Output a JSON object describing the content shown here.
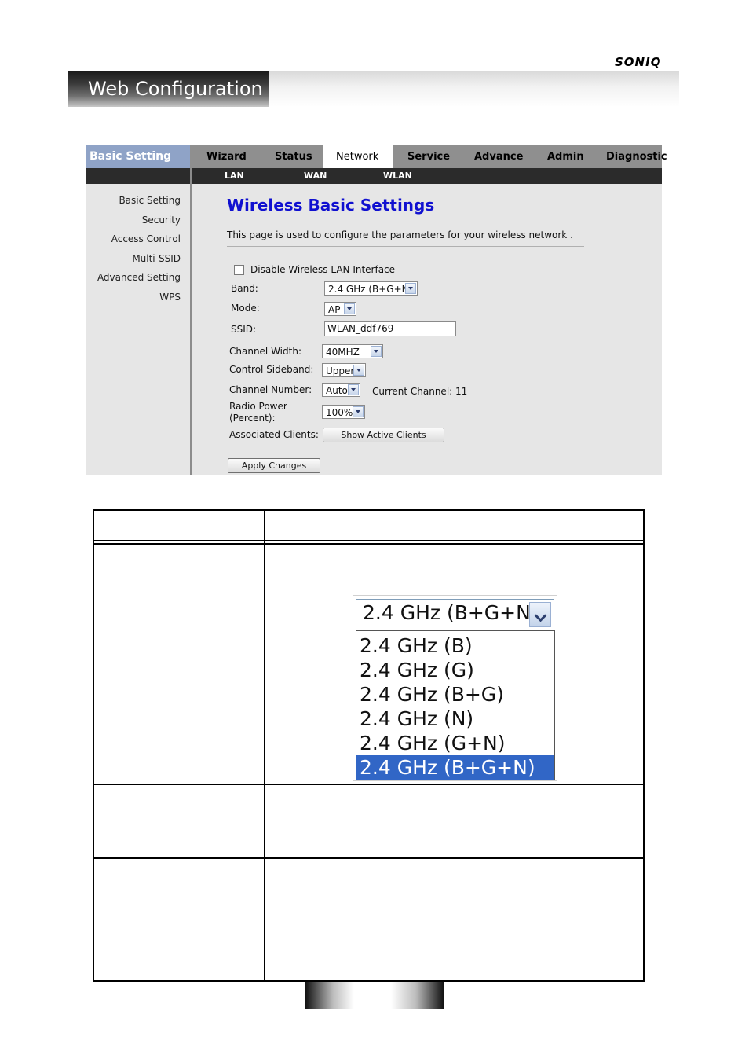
{
  "brand": "SONIQ",
  "banner": {
    "title": "Web Configuration"
  },
  "nav": {
    "items": [
      "Basic Setting",
      "Wizard",
      "Status",
      "Network",
      "Service",
      "Advance",
      "Admin",
      "Diagnostic"
    ],
    "active": "Network",
    "subitems": [
      "LAN",
      "WAN",
      "WLAN"
    ]
  },
  "sidebar": {
    "items": [
      "Basic Setting",
      "Security",
      "Access Control",
      "Multi-SSID",
      "Advanced Setting",
      "WPS"
    ]
  },
  "main": {
    "title": "Wireless Basic Settings",
    "description": "This page is used to configure the parameters for your wireless network .",
    "disable_label": "Disable Wireless LAN Interface",
    "band_label": "Band:",
    "band_value": "2.4 GHz (B+G+N)",
    "mode_label": "Mode:",
    "mode_value": "AP",
    "ssid_label": "SSID:",
    "ssid_value": "WLAN_ddf769",
    "cw_label": "Channel Width:",
    "cw_value": "40MHZ",
    "cs_label": "Control Sideband:",
    "cs_value": "Upper",
    "cn_label": "Channel Number:",
    "cn_value": "Auto",
    "current_channel_label": "Current Channel:",
    "current_channel_value": "11",
    "rp_label_1": "Radio Power",
    "rp_label_2": "(Percent):",
    "rp_value": "100%",
    "ac_label": "Associated Clients:",
    "show_clients_button": "Show Active Clients",
    "apply_button": "Apply Changes"
  },
  "dropdown_zoom": {
    "selected": "2.4 GHz (B+G+N)",
    "options": [
      "2.4 GHz (B)",
      "2.4 GHz (G)",
      "2.4 GHz (B+G)",
      "2.4 GHz (N)",
      "2.4 GHz (G+N)",
      "2.4 GHz (B+G+N)"
    ],
    "highlighted": "2.4 GHz (B+G+N)"
  }
}
